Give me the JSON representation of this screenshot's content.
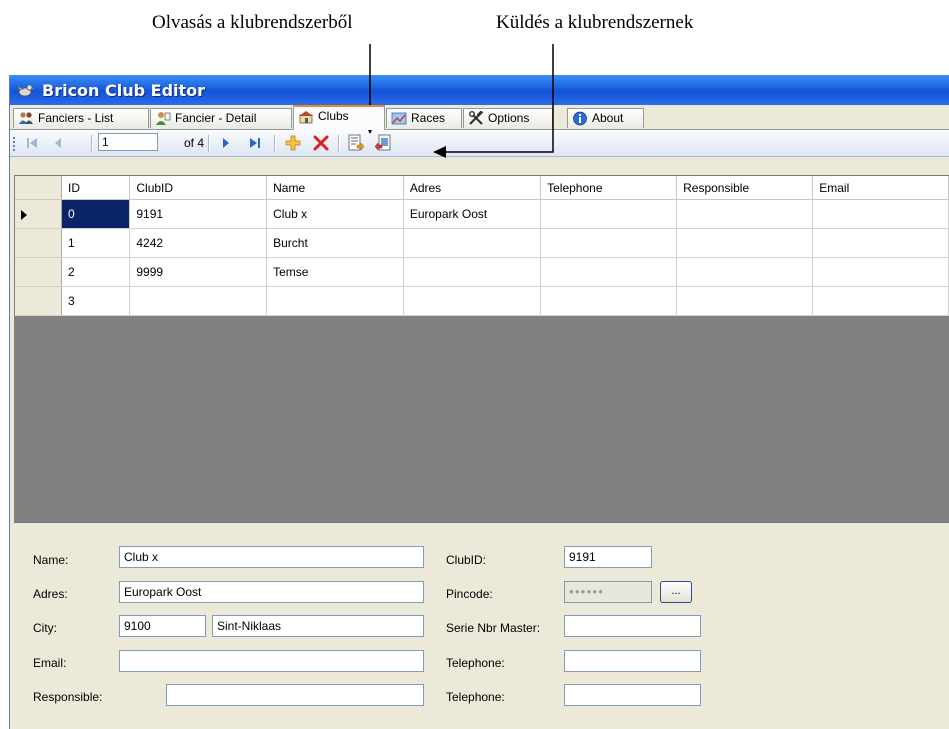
{
  "annotations": {
    "read_label": "Olvasás a klubrendszerből",
    "send_label": "Küldés a klubrendszernek"
  },
  "window": {
    "title": "Bricon Club Editor",
    "accent": "#1a5fe0"
  },
  "tabs": [
    {
      "label": "Fanciers - List",
      "icon": "users-icon"
    },
    {
      "label": "Fancier - Detail",
      "icon": "user-detail-icon"
    },
    {
      "label": "Clubs",
      "icon": "clubs-icon",
      "active": true
    },
    {
      "label": "Races",
      "icon": "races-icon"
    },
    {
      "label": "Options",
      "icon": "tools-icon"
    },
    {
      "label": "About",
      "icon": "info-icon"
    }
  ],
  "navigator": {
    "position": "1",
    "count_text": "of 4"
  },
  "grid": {
    "columns": [
      "ID",
      "ClubID",
      "Name",
      "Adres",
      "Telephone",
      "Responsible",
      "Email"
    ],
    "rows": [
      {
        "ID": "0",
        "ClubID": "9191",
        "Name": "Club x",
        "Adres": "Europark Oost",
        "Telephone": "",
        "Responsible": "",
        "Email": "",
        "current": true
      },
      {
        "ID": "1",
        "ClubID": "4242",
        "Name": "Burcht",
        "Adres": "",
        "Telephone": "",
        "Responsible": "",
        "Email": ""
      },
      {
        "ID": "2",
        "ClubID": "9999",
        "Name": "Temse",
        "Adres": "",
        "Telephone": "",
        "Responsible": "",
        "Email": ""
      },
      {
        "ID": "3",
        "ClubID": "",
        "Name": "",
        "Adres": "",
        "Telephone": "",
        "Responsible": "",
        "Email": ""
      }
    ]
  },
  "detail": {
    "name_label": "Name:",
    "name_value": "Club x",
    "adres_label": "Adres:",
    "adres_value": "Europark Oost",
    "city_label": "City:",
    "postcode_value": "9100",
    "city_value": "Sint-Niklaas",
    "email_label": "Email:",
    "email_value": "",
    "responsible_label": "Responsible:",
    "responsible_value": "",
    "clubid_label": "ClubID:",
    "clubid_value": "9191",
    "pincode_label": "Pincode:",
    "pincode_value": "●●●●●●",
    "browse_label": "...",
    "serie_label": "Serie Nbr Master:",
    "serie_value": "",
    "telephone1_label": "Telephone:",
    "telephone1_value": "",
    "telephone2_label": "Telephone:",
    "telephone2_value": ""
  }
}
